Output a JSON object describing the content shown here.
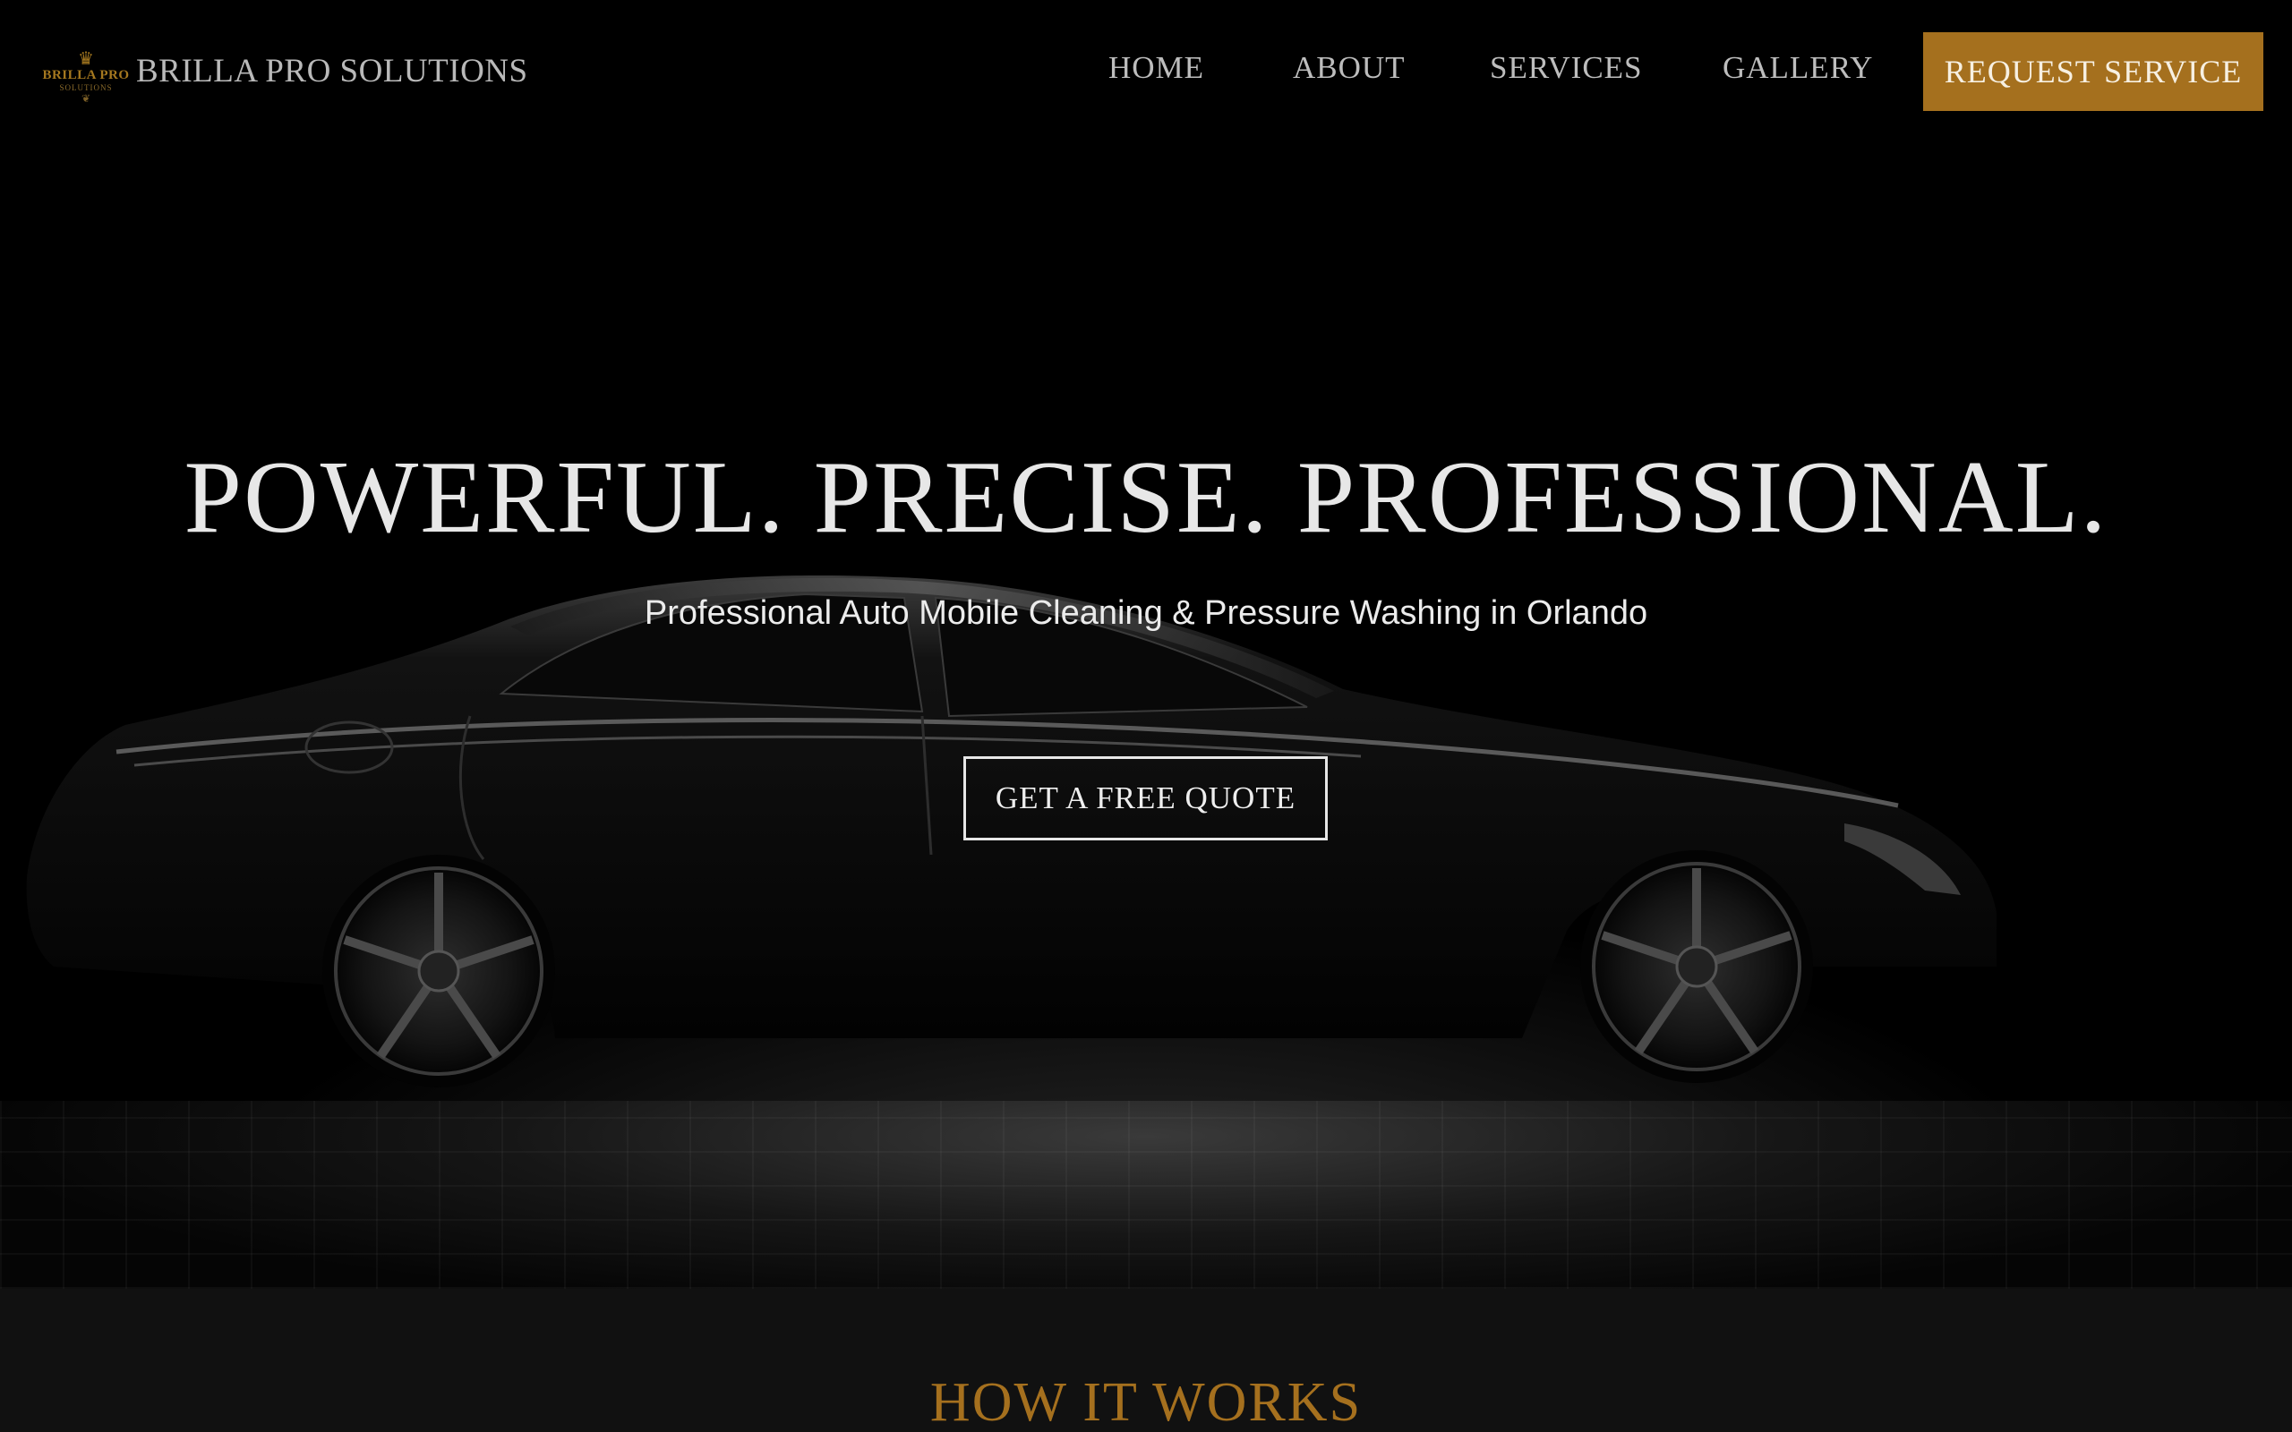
{
  "brand": {
    "logo_text": "BRILLA PRO",
    "logo_sub": "SOLUTIONS",
    "name": "BRILLA PRO SOLUTIONS"
  },
  "nav": {
    "items": [
      {
        "label": "HOME"
      },
      {
        "label": "ABOUT"
      },
      {
        "label": "SERVICES"
      },
      {
        "label": "GALLERY"
      }
    ],
    "cta_label": "REQUEST SERVICE"
  },
  "hero": {
    "headline": "POWERFUL. PRECISE. PROFESSIONAL.",
    "subheadline": "Professional Auto Mobile Cleaning & Pressure Washing in Orlando",
    "button_label": "GET A FREE QUOTE",
    "image": "black-sedan-silhouette"
  },
  "how_it_works": {
    "title": "HOW IT WORKS"
  },
  "colors": {
    "accent": "#a5701e",
    "background": "#000000",
    "section_bg": "#111111",
    "text_light": "#e7e7e7"
  }
}
